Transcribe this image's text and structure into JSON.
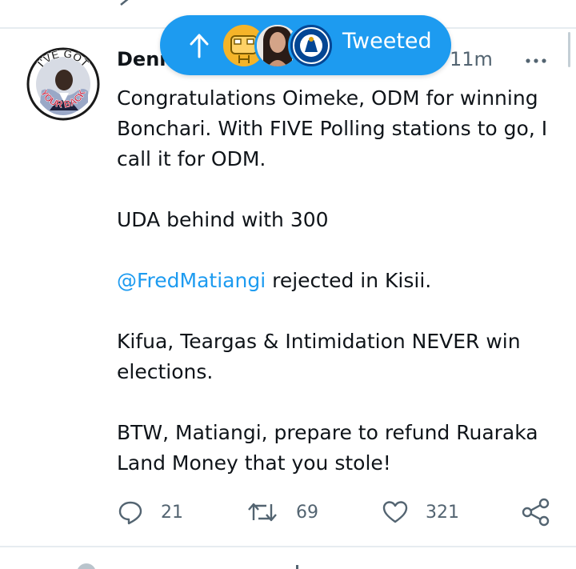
{
  "toast": {
    "label": "Tweeted",
    "arrow_icon": "arrow-up-icon",
    "avatars": [
      "emoji-avatar",
      "portrait-avatar",
      "chelsea-crest-avatar"
    ]
  },
  "tweet": {
    "author_name_visible": "Denn",
    "timestamp": "11m",
    "avatar_text_top": "I'VE GOT",
    "avatar_text_bottom": "YOUR BACK",
    "lines": [
      "Congratulations Oimeke, ODM for  winning Bonchari. With FIVE Polling stations to go, I call it for ODM.",
      "UDA behind with 300",
      "rejected in Kisii.",
      "Kifua, Teargas & Intimidation NEVER win elections.",
      "BTW, Matiangi, prepare to refund Ruaraka Land Money that you stole!"
    ],
    "mention": "@FredMatiangi",
    "reply_count": "21",
    "retweet_count": "69",
    "like_count": "321"
  },
  "colors": {
    "accent": "#1d9bf0",
    "text": "#0f1419",
    "muted": "#536471",
    "divider": "#e6ecf0"
  }
}
